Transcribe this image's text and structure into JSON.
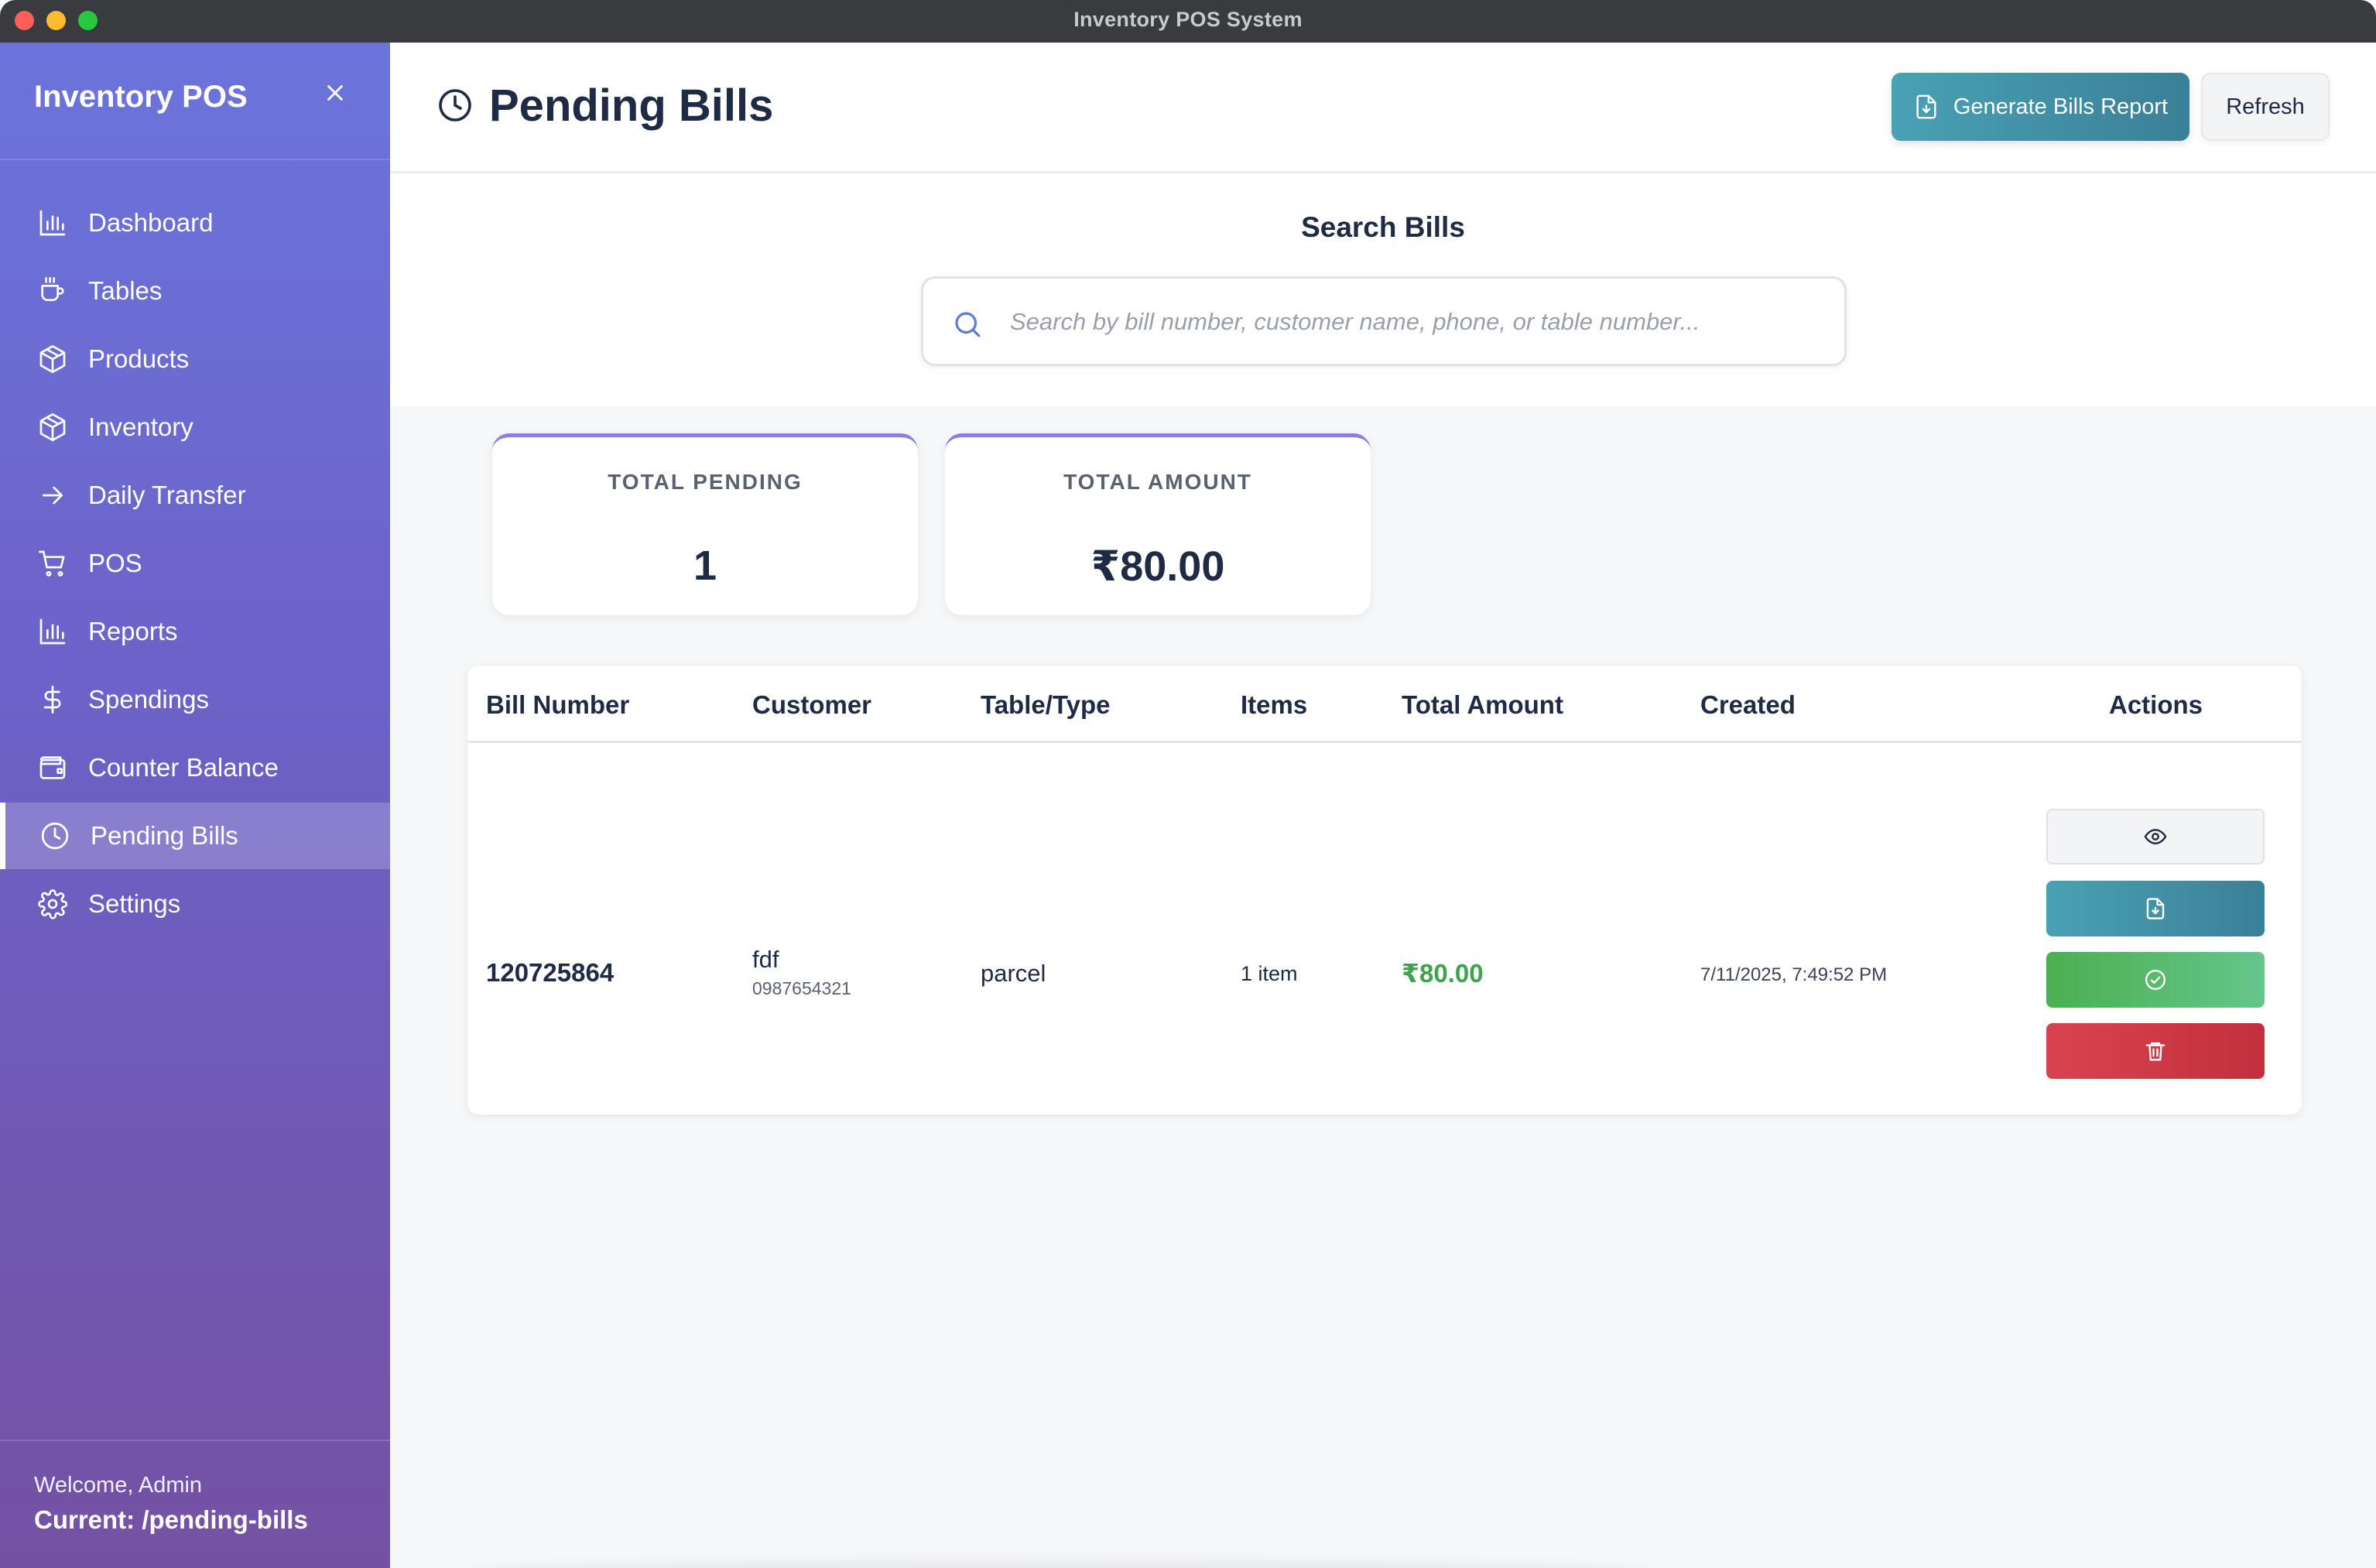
{
  "window": {
    "title": "Inventory POS System"
  },
  "sidebar": {
    "brand": "Inventory POS",
    "items": [
      {
        "label": "Dashboard",
        "icon": "bar-chart-icon"
      },
      {
        "label": "Tables",
        "icon": "coffee-icon"
      },
      {
        "label": "Products",
        "icon": "package-icon"
      },
      {
        "label": "Inventory",
        "icon": "package-icon"
      },
      {
        "label": "Daily Transfer",
        "icon": "arrow-right-icon"
      },
      {
        "label": "POS",
        "icon": "cart-icon"
      },
      {
        "label": "Reports",
        "icon": "bar-chart-icon"
      },
      {
        "label": "Spendings",
        "icon": "dollar-icon"
      },
      {
        "label": "Counter Balance",
        "icon": "wallet-icon"
      },
      {
        "label": "Pending Bills",
        "icon": "clock-icon",
        "active": true
      },
      {
        "label": "Settings",
        "icon": "gear-icon"
      }
    ],
    "welcome": "Welcome, Admin",
    "current": "Current: /pending-bills"
  },
  "header": {
    "title": "Pending Bills",
    "generate_label": "Generate Bills Report",
    "refresh_label": "Refresh"
  },
  "search": {
    "title": "Search Bills",
    "placeholder": "Search by bill number, customer name, phone, or table number...",
    "value": ""
  },
  "stats": [
    {
      "label": "TOTAL PENDING",
      "value": "1"
    },
    {
      "label": "TOTAL AMOUNT",
      "value": "₹80.00"
    }
  ],
  "table": {
    "columns": [
      "Bill Number",
      "Customer",
      "Table/Type",
      "Items",
      "Total Amount",
      "Created",
      "Actions"
    ],
    "rows": [
      {
        "bill_number": "120725864",
        "customer_name": "fdf",
        "customer_phone": "0987654321",
        "table_type": "parcel",
        "items": "1 item",
        "total_amount": "₹80.00",
        "created": "7/11/2025, 7:49:52 PM"
      }
    ]
  },
  "colors": {
    "accent_teal": "#3f8fa5",
    "success_green": "#3fa34d",
    "danger_red": "#cc3a45",
    "sidebar_top": "#6b74dc",
    "sidebar_bottom": "#7451a3"
  }
}
